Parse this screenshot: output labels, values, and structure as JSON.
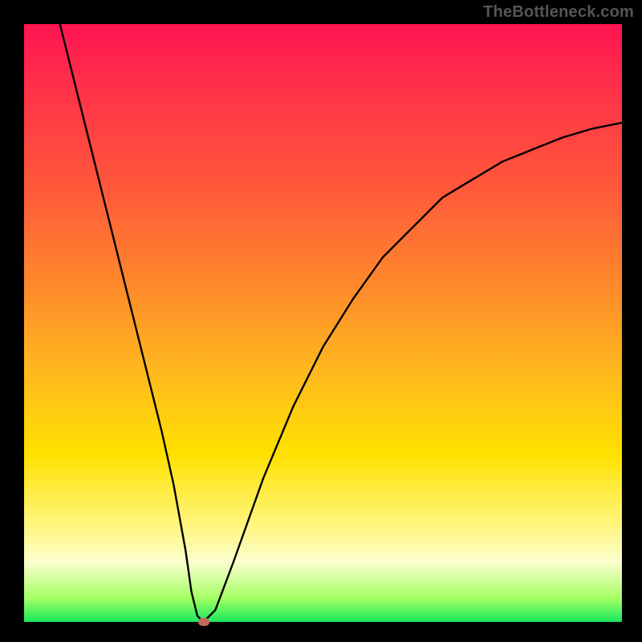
{
  "watermark": "TheBottleneck.com",
  "chart_data": {
    "type": "line",
    "title": "",
    "xlabel": "",
    "ylabel": "",
    "xlim": [
      0,
      100
    ],
    "ylim": [
      0,
      100
    ],
    "grid": false,
    "series": [
      {
        "name": "curve",
        "x": [
          6,
          10,
          15,
          20,
          23,
          25,
          27,
          28,
          29,
          30,
          32,
          35,
          40,
          45,
          50,
          55,
          60,
          65,
          70,
          75,
          80,
          85,
          90,
          95,
          100
        ],
        "values": [
          100,
          84,
          64,
          44,
          32,
          23,
          12,
          5,
          1,
          0,
          2,
          10,
          24,
          36,
          46,
          54,
          61,
          66,
          71,
          74,
          77,
          79,
          81,
          82.5,
          83.5
        ]
      }
    ],
    "annotations": [
      {
        "type": "marker",
        "x": 30,
        "y": 0,
        "color": "#c4695e"
      }
    ],
    "colors": {
      "line": "#000000",
      "gradient_top": "#ff1452",
      "gradient_mid1": "#ffb81f",
      "gradient_mid2": "#fff680",
      "gradient_bottom": "#18e85c"
    }
  }
}
